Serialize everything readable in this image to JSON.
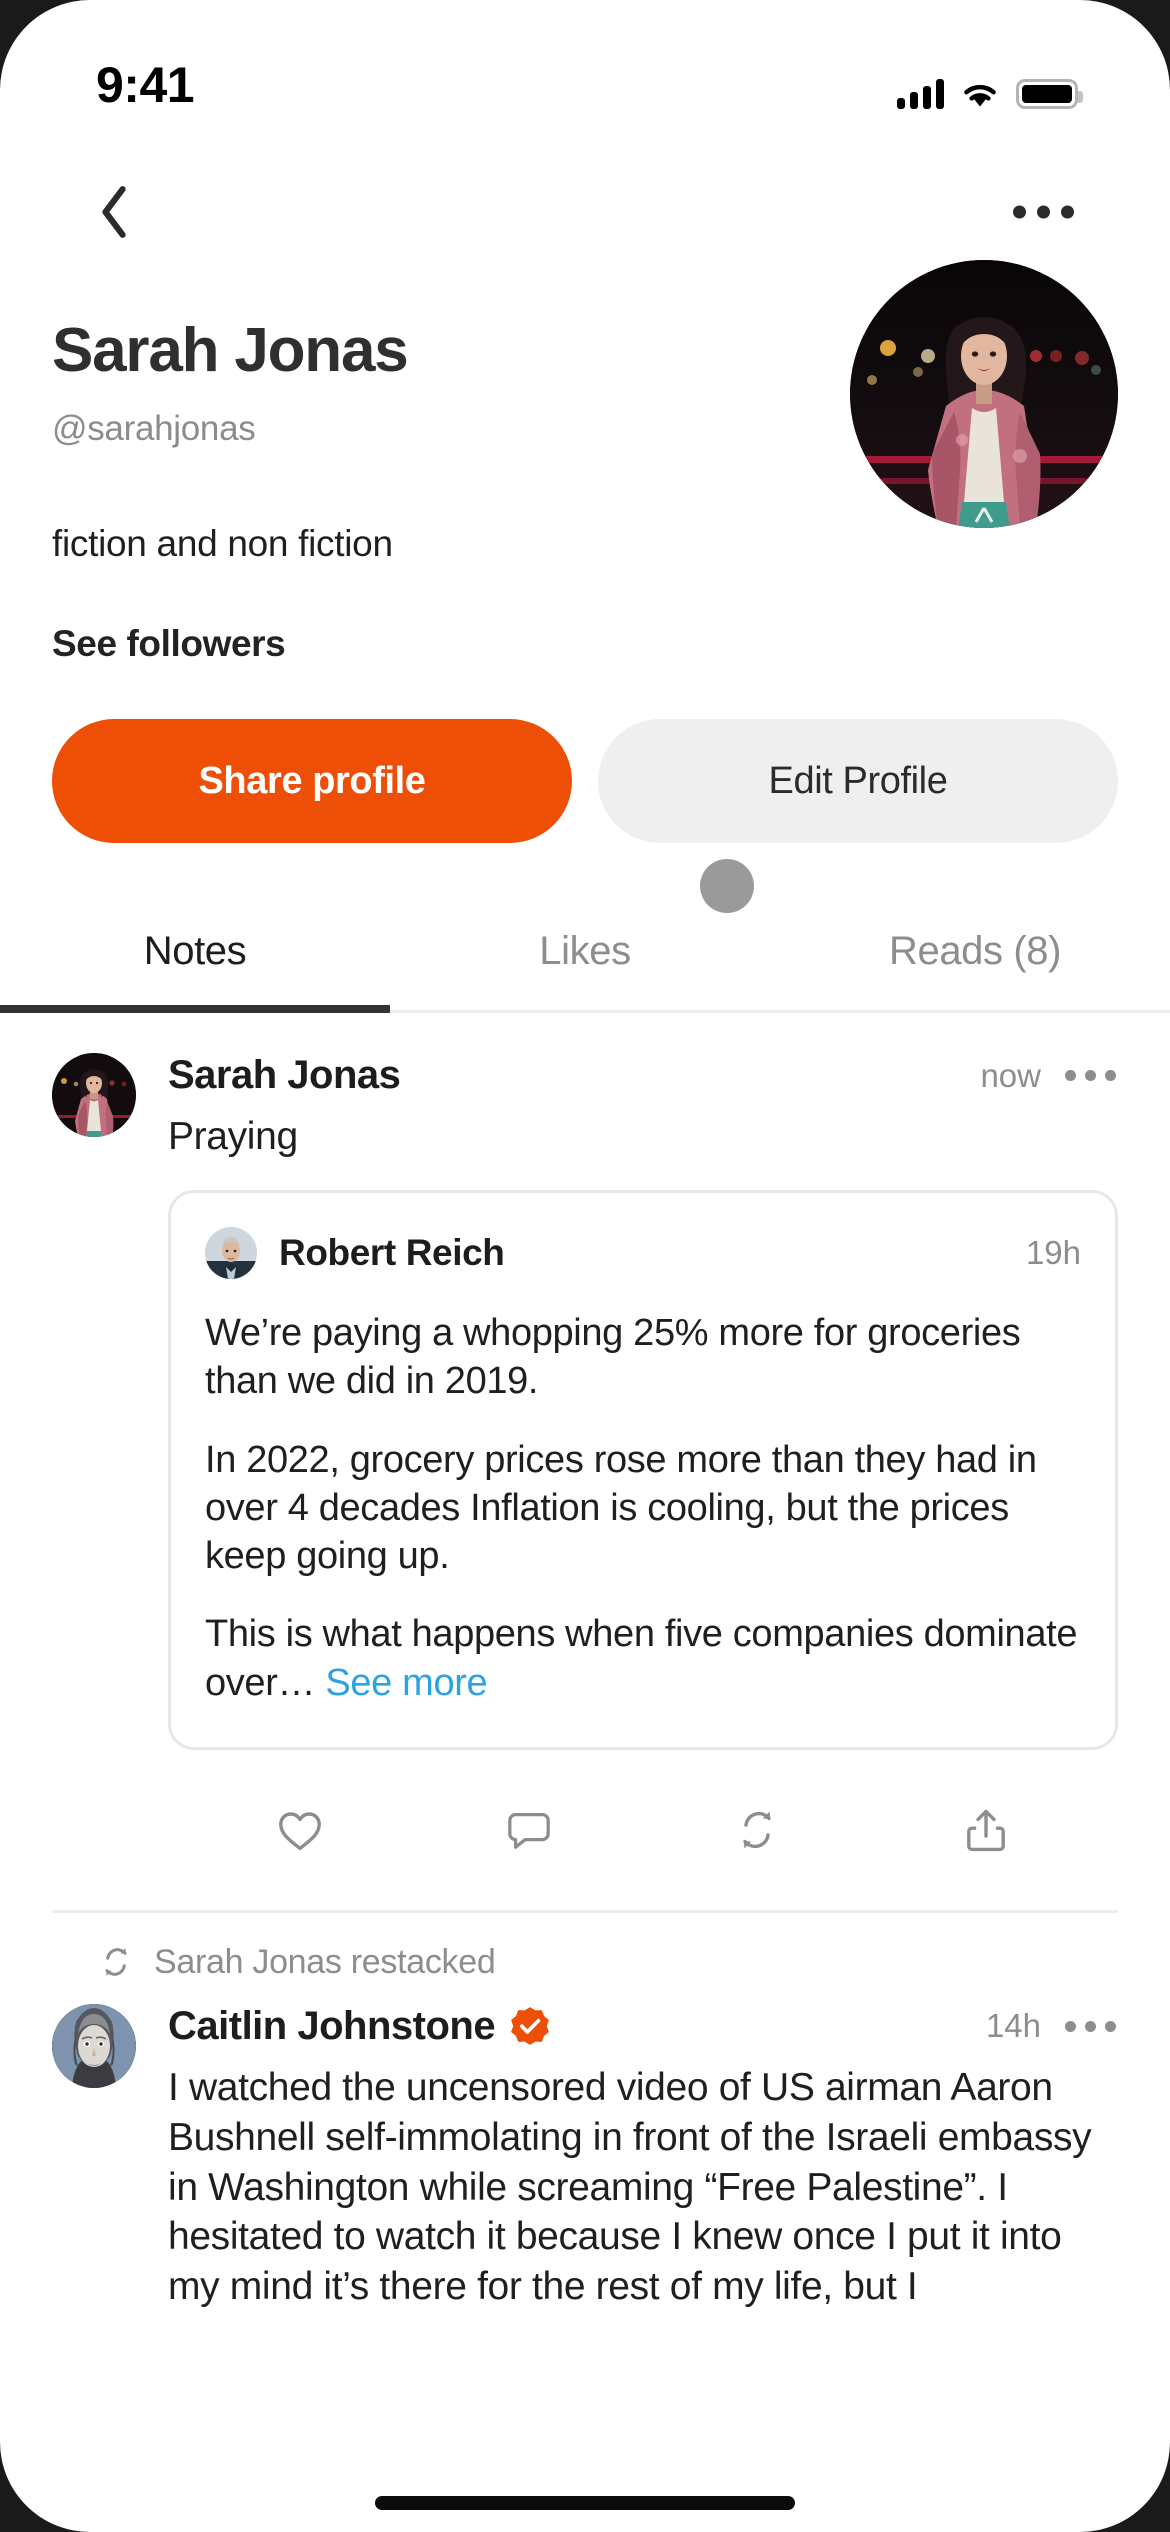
{
  "status_bar": {
    "time": "9:41",
    "icons": [
      "signal-icon",
      "wifi-icon",
      "battery-icon"
    ]
  },
  "nav": {
    "back_icon": "chevron-left-icon",
    "more_icon": "ellipsis-icon"
  },
  "profile": {
    "name": "Sarah Jonas",
    "handle": "@sarahjonas",
    "bio": "fiction and non fiction",
    "followers_link": "See followers",
    "avatar_alt": "sarah-jonas-avatar",
    "share_button": "Share profile",
    "edit_button": "Edit Profile",
    "accent_color": "#ee4f06",
    "secondary_button_color": "#efeff0"
  },
  "tabs": [
    {
      "label": "Notes",
      "active": true
    },
    {
      "label": "Likes",
      "active": false
    },
    {
      "label": "Reads (8)",
      "active": false
    }
  ],
  "feed": {
    "posts": [
      {
        "author": "Sarah Jonas",
        "time": "now",
        "text": "Praying",
        "quote": {
          "author": "Robert Reich",
          "time": "19h",
          "paragraphs": [
            "We’re paying a whopping 25% more for groceries than we did in 2019.",
            "In 2022, grocery prices rose more than they had in over 4 decades Inflation is cooling, but the prices keep going up.",
            "This is what happens when five companies dominate over… "
          ],
          "see_more": "See more",
          "link_color": "#2ba3e3"
        },
        "actions": [
          "like-icon",
          "comment-icon",
          "restack-icon",
          "share-icon"
        ]
      },
      {
        "restack_banner": "Sarah Jonas restacked",
        "author": "Caitlin Johnstone",
        "verified": true,
        "verified_color": "#ee4f06",
        "time": "14h",
        "text": "I watched the uncensored video of US airman Aaron Bushnell self-immolating in front of the Israeli embassy in Washington while screaming “Free Palestine”. I hesitated to watch it because I knew once I put it into my mind it’s there for the rest of my life, but I"
      }
    ]
  }
}
